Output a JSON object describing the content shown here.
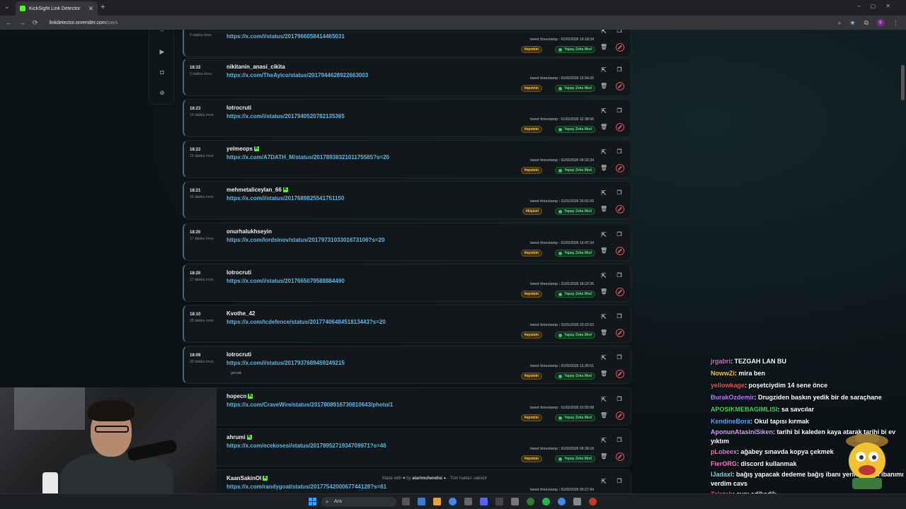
{
  "browser": {
    "tab_title": "KickSight Link Detector",
    "url_host": "linkdetector.onrender.com",
    "url_path": "/cavs",
    "new_tab": "+",
    "close_tab": "✕"
  },
  "rows": [
    {
      "time": "18:32",
      "ago": "5 dakika önce",
      "user": "",
      "kick": false,
      "link": "https://x.com/i/status/2017966058414465031",
      "timestamp": "tweet timestamp : 01/02/2026 14:18:34",
      "tag": "#epstein",
      "mod": "Yapay Zeka Mod",
      "note": ""
    },
    {
      "time": "18:32",
      "ago": "5 dakika önce",
      "user": "nikitanin_anasi_cikita",
      "kick": false,
      "link": "https://x.com/TheAyico/status/2017944628922663003",
      "timestamp": "tweet timestamp : 01/02/2026 12:54:25",
      "tag": "#epstein",
      "mod": "Yapay Zeka Mod",
      "note": ""
    },
    {
      "time": "18:23",
      "ago": "14 dakika önce",
      "user": "lotrocruti",
      "kick": false,
      "link": "https://x.com/i/status/2017940520782135365",
      "timestamp": "tweet timestamp : 01/02/2026 12:38:06",
      "tag": "#epstein",
      "mod": "Yapay Zeka Mod",
      "note": ""
    },
    {
      "time": "18:22",
      "ago": "15 dakika önce",
      "user": "yelmeops",
      "kick": true,
      "link": "https://x.com/A7DATH_M/status/2017893832101175585?s=20",
      "timestamp": "tweet timestamp : 01/02/2026 09:32:34",
      "tag": "#epstein",
      "mod": "Yapay Zeka Mod",
      "note": ""
    },
    {
      "time": "18:21",
      "ago": "16 dakika önce",
      "user": "mehmetaliceylan_66",
      "kick": true,
      "link": "https://x.com/i/status/2017689825541751150",
      "timestamp": "tweet timestamp : 31/01/2026 20:01:55",
      "tag": "#kişisel",
      "mod": "Yapay Zeka Mod",
      "note": ""
    },
    {
      "time": "18:20",
      "ago": "17 dakika önce",
      "user": "onurhalukhseyin",
      "kick": false,
      "link": "https://x.com/lordsinov/status/2017973103301673106?s=20",
      "timestamp": "tweet timestamp : 01/02/2026 14:47:34",
      "tag": "#epstein",
      "mod": "Yapay Zeka Mod",
      "note": ""
    },
    {
      "time": "18:20",
      "ago": "17 dakika önce",
      "user": "lotrocruti",
      "kick": false,
      "link": "https://x.com/i/status/2017665079588884490",
      "timestamp": "tweet timestamp : 31/01/2026 18:23:36",
      "tag": "#epstein",
      "mod": "Yapay Zeka Mod",
      "note": ""
    },
    {
      "time": "18:10",
      "ago": "28 dakika önce",
      "user": "Kvothe_42",
      "kick": false,
      "link": "https://x.com/tcdefence/status/2017740648451813443?s=20",
      "timestamp": "tweet timestamp : 31/01/2026 23:23:53",
      "tag": "#epstein",
      "mod": "Yapay Zeka Mod",
      "note": ""
    },
    {
      "time": "18:09",
      "ago": "28 dakika önce",
      "user": "lotrocruti",
      "kick": false,
      "link": "https://x.com/i/status/2017937689459249215",
      "timestamp": "tweet timestamp : 01/02/2026 12:26:51",
      "tag": "#epstein",
      "mod": "Yapay Zeka Mod",
      "note": "gerçek"
    },
    {
      "time": "",
      "ago": "",
      "user": "hopecn",
      "kick": true,
      "link": "https://x.com/CraveWire/status/2017808916730810643/photo/1",
      "timestamp": "tweet timestamp : 01/02/2026 03:55:08",
      "tag": "#epstein",
      "mod": "Yapay Zeka Mod",
      "note": ""
    },
    {
      "time": "",
      "ago": "",
      "user": "ahrumi",
      "kick": true,
      "link": "https://x.com/ecekosesi/status/2017895271934709971?s=46",
      "timestamp": "tweet timestamp : 01/02/2026 09:38:18",
      "tag": "#epstein",
      "mod": "Yapay Zeka Mod",
      "note": ""
    },
    {
      "time": "",
      "ago": "",
      "user": "KaanSakinOl",
      "kick": true,
      "link": "https://x.com/randygoat/status/2017754200067744128?s=61",
      "timestamp": "tweet timestamp : 01/02/2026 00:17:44",
      "tag": "#epstein",
      "mod": "Yapay Zeka Mod",
      "note": ""
    }
  ],
  "footer": {
    "made_with": "Made with",
    "by": "by",
    "author": "atarimuhendisi",
    "rights": "Tüm hakları saklıdır"
  },
  "chat": [
    {
      "nick": "jrgabri",
      "color": "#d66bd6",
      "text": ": TEZGAH LAN BU"
    },
    {
      "nick": "NowwZi",
      "color": "#f5c542",
      "text": ": mira ben"
    },
    {
      "nick": "yellowkage",
      "color": "#ff4a4a",
      "text": ": poşetciydim 14 sene önce"
    },
    {
      "nick": "BurakOzdemir",
      "color": "#b77cff",
      "text": ": Drugziden baskın yedik bir de saraçhane"
    },
    {
      "nick": "APOSIKMEBAGIMLISI",
      "color": "#3fd45a",
      "text": ": sa savcılar"
    },
    {
      "nick": "KendineBora",
      "color": "#5aa8ff",
      "text": ": Okul tapısı kırmak"
    },
    {
      "nick": "AponunAtasiniSiken",
      "color": "#d99bff",
      "text": ": tarihi bi kaleden kaya atarak tarihi bi ev yıktım"
    },
    {
      "nick": "pLobeex",
      "color": "#ff6adf",
      "text": ": ağabey sınavda kopya çekmek"
    },
    {
      "nick": "FierORG",
      "color": "#ff7bd0",
      "text": ": discord kullanmak"
    },
    {
      "nick": "lJadaxl",
      "color": "#6ad8ff",
      "text": ": bağış yapacak dedeme bağış ibanı yerine kendi ibanımı verdim cavs"
    },
    {
      "nick": "Teletab",
      "color": "#ff5555",
      "text": ": aynı sdjksdjk"
    }
  ],
  "taskbar": {
    "search": "Ara"
  },
  "icons": {
    "external": "external-link-icon",
    "copy": "copy-icon",
    "trash": "trash-icon",
    "block": "block-icon",
    "camera": "camera-icon",
    "photo": "photo-icon",
    "globe": "globe-icon"
  }
}
